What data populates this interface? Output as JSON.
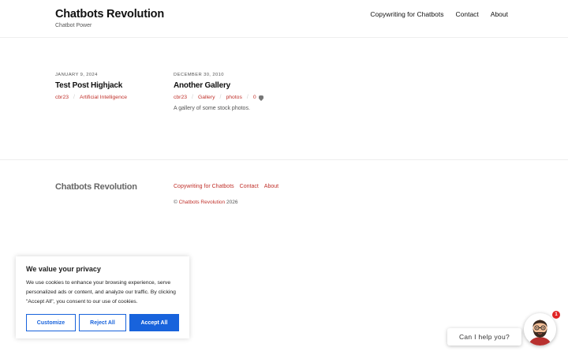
{
  "header": {
    "site_title": "Chatbots Revolution",
    "tagline": "Chatbot Power",
    "nav": [
      "Copywriting for Chatbots",
      "Contact",
      "About"
    ]
  },
  "posts": [
    {
      "date": "January 9, 2024",
      "title": "Test Post Highjack",
      "author": "cbr23",
      "categories": [
        "Artificial Intelligence"
      ],
      "comments": "",
      "excerpt": ""
    },
    {
      "date": "December 30, 2010",
      "title": "Another Gallery",
      "author": "cbr23",
      "categories": [
        "Gallery",
        "photos"
      ],
      "comments": "0",
      "excerpt": "A gallery of some stock photos."
    }
  ],
  "footer": {
    "site_title": "Chatbots Revolution",
    "nav": [
      "Copywriting for Chatbots",
      "Contact",
      "About"
    ],
    "copyright_prefix": "©",
    "copyright_link": "Chatbots Revolution",
    "copyright_year": "2026"
  },
  "cookie_banner": {
    "title": "We value your privacy",
    "text": "We use cookies to enhance your browsing experience, serve personalized ads or content, and analyze our traffic. By clicking \"Accept All\", you consent to our use of cookies.",
    "customize_label": "Customize",
    "reject_label": "Reject All",
    "accept_label": "Accept All"
  },
  "chat_widget": {
    "prompt": "Can I help you?",
    "badge_count": "1",
    "avatar_icon": "bearded-man-avatar-icon"
  },
  "colors": {
    "accent_red": "#c0312b",
    "cookie_blue": "#1863dc",
    "badge_red": "#e02424"
  }
}
